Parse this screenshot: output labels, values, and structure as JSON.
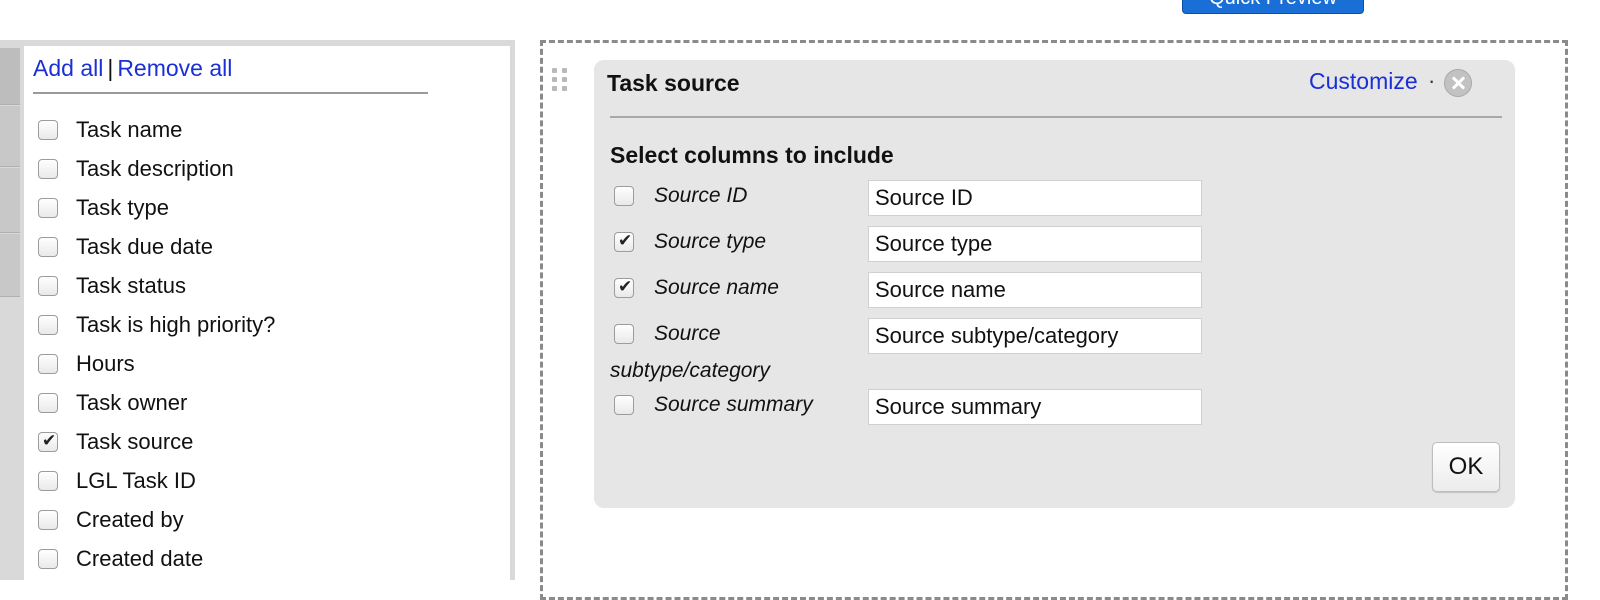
{
  "header": {
    "preview_button_label": "Quick Preview"
  },
  "left_panel": {
    "add_all_label": "Add all",
    "separator": "|",
    "remove_all_label": "Remove all",
    "columns": [
      {
        "label": "Task name",
        "checked": false
      },
      {
        "label": "Task description",
        "checked": false
      },
      {
        "label": "Task type",
        "checked": false
      },
      {
        "label": "Task due date",
        "checked": false
      },
      {
        "label": "Task status",
        "checked": false
      },
      {
        "label": "Task is high priority?",
        "checked": false
      },
      {
        "label": "Hours",
        "checked": false
      },
      {
        "label": "Task owner",
        "checked": false
      },
      {
        "label": "Task source",
        "checked": true
      },
      {
        "label": "LGL Task ID",
        "checked": false
      },
      {
        "label": "Created by",
        "checked": false
      },
      {
        "label": "Created date",
        "checked": false
      }
    ]
  },
  "widget": {
    "title": "Task source",
    "customize_label": "Customize",
    "dot_separator": "·",
    "section_heading": "Select columns to include",
    "options": [
      {
        "label": "Source ID",
        "checked": false,
        "value": "Source ID"
      },
      {
        "label": "Source type",
        "checked": true,
        "value": "Source type"
      },
      {
        "label": "Source name",
        "checked": true,
        "value": "Source name"
      },
      {
        "label": "Source",
        "label_wrap": "subtype/category",
        "checked": false,
        "value": "Source subtype/category"
      },
      {
        "label": "Source summary",
        "checked": false,
        "value": "Source summary"
      }
    ],
    "ok_label": "OK"
  }
}
